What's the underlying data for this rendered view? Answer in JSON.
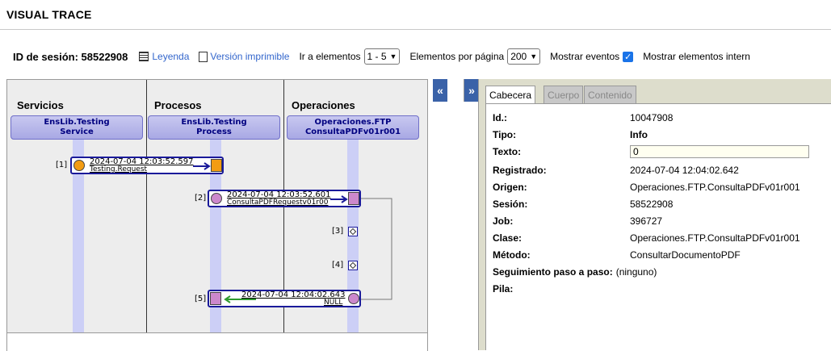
{
  "header": {
    "title": "VISUAL TRACE"
  },
  "toolbar": {
    "session_label": "ID de sesión: 58522908",
    "legend_link": "Leyenda",
    "print_link": "Versión imprimible",
    "goto_label": "Ir a elementos",
    "goto_value": "1 - 5",
    "perpage_label": "Elementos por página",
    "perpage_value": "200",
    "show_events_label": "Mostrar eventos",
    "show_internal_label": "Mostrar elementos intern"
  },
  "diagram": {
    "columns": [
      {
        "title": "Servicios",
        "box_line1": "EnsLib.Testing",
        "box_line2": "Service"
      },
      {
        "title": "Procesos",
        "box_line1": "EnsLib.Testing",
        "box_line2": "Process"
      },
      {
        "title": "Operaciones",
        "box_line1": "Operaciones.FTP",
        "box_line2": "ConsultaPDFv01r001"
      }
    ],
    "messages": [
      {
        "index": "[1]",
        "timestamp": "2024-07-04 12:03:52.597",
        "name": "Testing.Request"
      },
      {
        "index": "[2]",
        "timestamp": "2024-07-04 12:03:52.601",
        "name": "ConsultaPDFRequestv01r00"
      },
      {
        "index": "[3]"
      },
      {
        "index": "[4]"
      },
      {
        "index": "[5]",
        "timestamp": "2024-07-04 12:04:02.643",
        "name": "NULL"
      }
    ],
    "colors": {
      "msg_border": "#1a1a9a",
      "service_node": "#f39c12",
      "process_node": "#cc88cc",
      "return_arrow": "#2e9a2e"
    }
  },
  "buttons": {
    "collapse_left": "«",
    "collapse_right": "»"
  },
  "tabs": [
    {
      "label": "Cabecera",
      "active": true
    },
    {
      "label": "Cuerpo",
      "active": false
    },
    {
      "label": "Contenido",
      "active": false
    }
  ],
  "details": [
    {
      "key": "Id.:",
      "value": "10047908"
    },
    {
      "key": "Tipo:",
      "value": "Info"
    },
    {
      "key": "Texto:",
      "value": "0"
    },
    {
      "key": "Registrado:",
      "value": "2024-07-04 12:04:02.642"
    },
    {
      "key": "Origen:",
      "value": "Operaciones.FTP.ConsultaPDFv01r001"
    },
    {
      "key": "Sesión:",
      "value": "58522908"
    },
    {
      "key": "Job:",
      "value": "396727"
    },
    {
      "key": "Clase:",
      "value": "Operaciones.FTP.ConsultaPDFv01r001"
    },
    {
      "key": "Método:",
      "value": "ConsultarDocumentoPDF"
    },
    {
      "key": "Seguimiento paso a paso:",
      "value": "(ninguno)"
    },
    {
      "key": "Pila:",
      "value": ""
    }
  ]
}
